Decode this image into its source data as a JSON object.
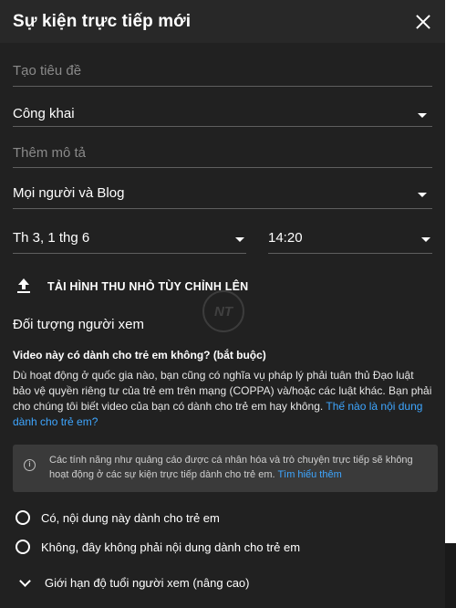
{
  "header": {
    "title": "Sự kiện trực tiếp mới"
  },
  "form": {
    "title_placeholder": "Tạo tiêu đề",
    "visibility_value": "Công khai",
    "description_placeholder": "Thêm mô tả",
    "category_value": "Mọi người và Blog",
    "date_value": "Th 3, 1 thg 6",
    "time_value": "14:20"
  },
  "upload": {
    "label": "TẢI HÌNH THU NHỎ TÙY CHỈNH LÊN"
  },
  "watermark": {
    "text": "NT"
  },
  "audience": {
    "section_title": "Đối tượng người xem",
    "question": "Video này có dành cho trẻ em không? (bắt buộc)",
    "paragraph": "Dù hoạt động ở quốc gia nào, bạn cũng có nghĩa vụ pháp lý phải tuân thủ Đạo luật bảo vệ quyền riêng tư của trẻ em trên mạng (COPPA) và/hoặc các luật khác. Bạn phải cho chúng tôi biết video của bạn có dành cho trẻ em hay không. ",
    "paragraph_link": "Thế nào là nội dung dành cho trẻ em?",
    "info_text": "Các tính năng như quảng cáo được cá nhân hóa và trò chuyện trực tiếp sẽ không hoạt động ở các sự kiện trực tiếp dành cho trẻ em. ",
    "info_link": "Tìm hiểu thêm",
    "option_yes": "Có, nội dung này dành cho trẻ em",
    "option_no": "Không, đây không phải nội dung dành cho trẻ em",
    "age_restriction": "Giới hạn độ tuổi người xem (nâng cao)"
  },
  "colors": {
    "background": "#212121",
    "header": "#282828",
    "link": "#3ea6ff",
    "info_box": "#3a3a3a"
  }
}
